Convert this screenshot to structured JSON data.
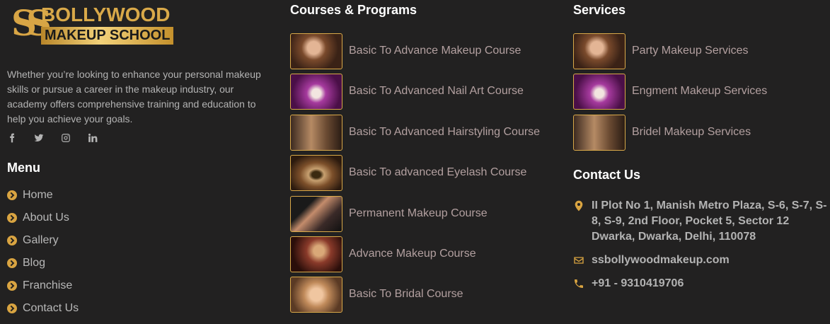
{
  "brand": {
    "logo_mark": "SS",
    "logo_top": "BOLLYWOOD",
    "logo_bottom": "MAKEUP SCHOOL",
    "accent_color": "#d9a441"
  },
  "about": {
    "text": "Whether you’re looking to enhance your personal makeup skills or pursue a career in the makeup industry, our academy offers comprehensive training and education to help you achieve your goals."
  },
  "social": [
    {
      "icon": "facebook-icon"
    },
    {
      "icon": "twitter-icon"
    },
    {
      "icon": "instagram-icon"
    },
    {
      "icon": "linkedin-icon"
    }
  ],
  "menu": {
    "title": "Menu",
    "items": [
      {
        "label": "Home"
      },
      {
        "label": "About Us"
      },
      {
        "label": "Gallery"
      },
      {
        "label": "Blog"
      },
      {
        "label": "Franchise"
      },
      {
        "label": "Contact Us"
      }
    ]
  },
  "courses": {
    "title": "Courses & Programs",
    "items": [
      {
        "label": "Basic To Advance Makeup Course"
      },
      {
        "label": "Basic To Advanced Nail Art Course"
      },
      {
        "label": "Basic To Advanced Hairstyling Course"
      },
      {
        "label": "Basic To advanced Eyelash Course"
      },
      {
        "label": "Permanent Makeup Course"
      },
      {
        "label": "Advance Makeup Course"
      },
      {
        "label": "Basic To Bridal Course"
      }
    ]
  },
  "services": {
    "title": "Services",
    "items": [
      {
        "label": "Party Makeup Services"
      },
      {
        "label": "Engment Makeup Services"
      },
      {
        "label": "Bridel Makeup Services"
      }
    ]
  },
  "contact": {
    "title": "Contact Us",
    "address": "II Plot No 1, Manish Metro Plaza, S-6, S-7, S-8, S-9, 2nd Floor, Pocket 5, Sector 12 Dwarka, Dwarka, Delhi, 110078",
    "email": "ssbollywoodmakeup.com",
    "phone": "+91 - 9310419706"
  }
}
